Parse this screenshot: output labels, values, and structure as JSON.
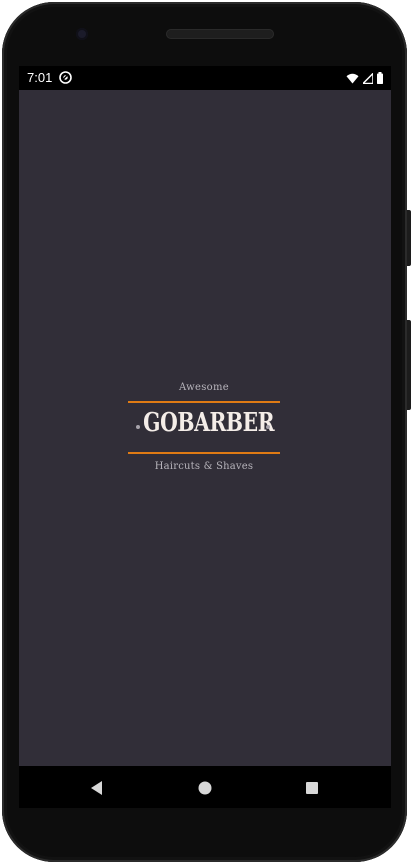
{
  "status_bar": {
    "time": "7:01",
    "app_icon": "sync-circle-icon",
    "icons": [
      "wifi-icon",
      "cellular-signal-icon",
      "battery-icon"
    ]
  },
  "logo": {
    "top_text": "Awesome",
    "main_text": "GOBARBER",
    "bottom_text": "Haircuts & Shaves"
  },
  "navigation_bar": {
    "back": "back-triangle-icon",
    "home": "home-circle-icon",
    "recent": "recent-apps-square-icon"
  },
  "colors": {
    "background": "#312e38",
    "accent": "#e07b14",
    "logo_text": "#f4ede8",
    "subtitle": "#b7b4bb"
  }
}
